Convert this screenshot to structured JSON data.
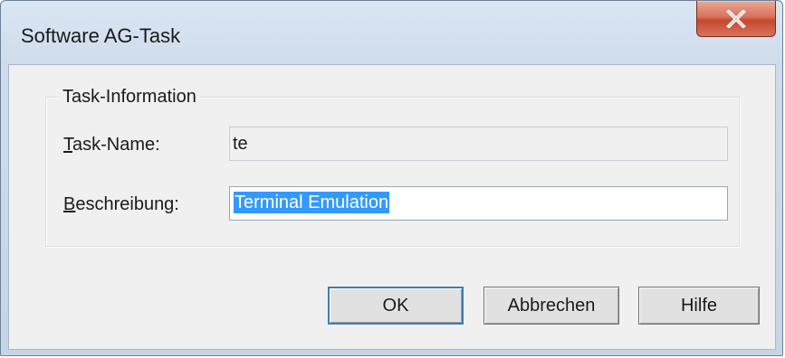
{
  "window": {
    "title": "Software AG-Task",
    "close_icon": "close-icon"
  },
  "group": {
    "legend": "Task-Information"
  },
  "fields": {
    "task_name": {
      "label_mnemonic": "T",
      "label_rest": "ask-Name:",
      "value": "te"
    },
    "beschreibung": {
      "label_mnemonic": "B",
      "label_rest": "eschreibung:",
      "value": "Terminal Emulation"
    }
  },
  "buttons": {
    "ok": "OK",
    "abbrechen": "Abbrechen",
    "hilfe": "Hilfe"
  },
  "colors": {
    "selection": "#3399ff",
    "close_button": "#c4482e",
    "default_button_border": "#3c7fb1"
  }
}
